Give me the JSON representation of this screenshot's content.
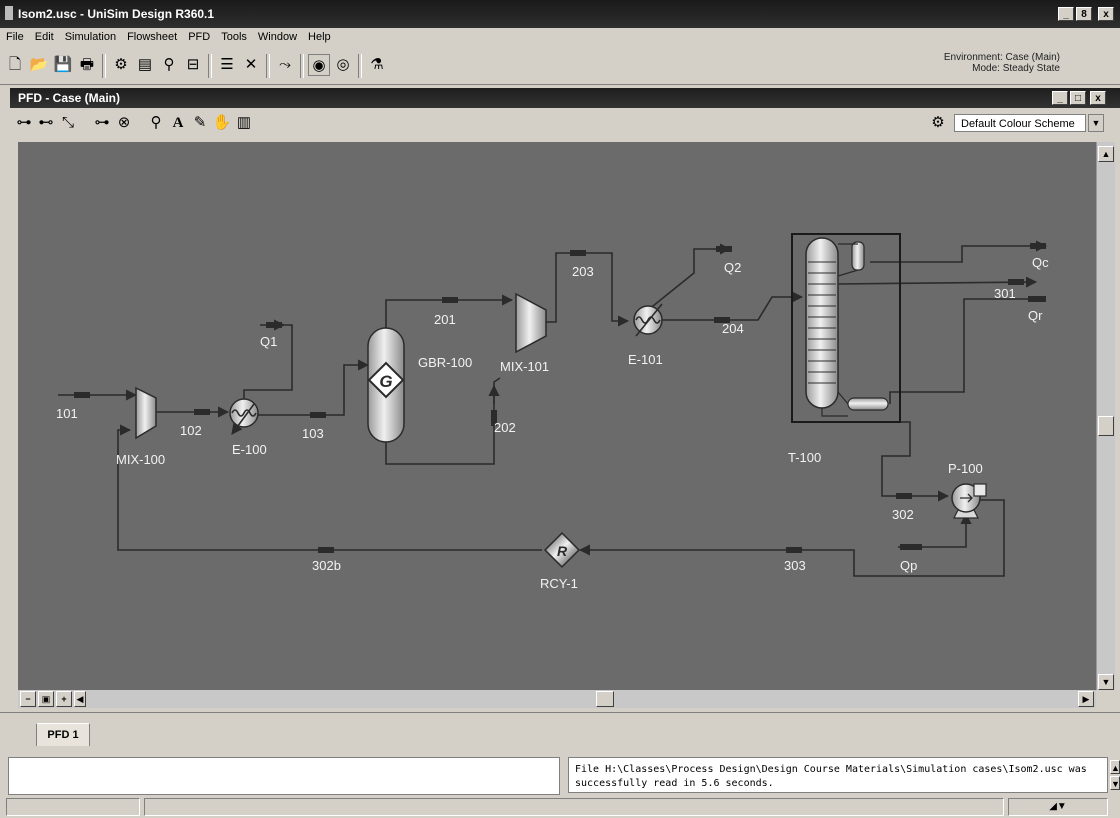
{
  "window": {
    "title": "Isom2.usc - UniSim Design R360.1",
    "min": "_",
    "max": "8",
    "close": "x"
  },
  "menu": [
    "File",
    "Edit",
    "Simulation",
    "Flowsheet",
    "PFD",
    "Tools",
    "Window",
    "Help"
  ],
  "environment": {
    "line1": "Environment: Case (Main)",
    "line2": "Mode: Steady State"
  },
  "pfd_window": {
    "title": "PFD - Case (Main)",
    "colour_scheme": "Default Colour Scheme"
  },
  "flowsheet": {
    "streams": [
      "101",
      "102",
      "103",
      "Q1",
      "201",
      "202",
      "203",
      "204",
      "Q2",
      "Qc",
      "301",
      "Qr",
      "302",
      "Qp",
      "303",
      "302b"
    ],
    "units": [
      "MIX-100",
      "E-100",
      "GBR-100",
      "MIX-101",
      "E-101",
      "T-100",
      "P-100",
      "RCY-1"
    ],
    "reactor_symbol": "G",
    "recycle_symbol": "R"
  },
  "tabs": [
    "PFD 1"
  ],
  "status": {
    "message": "File H:\\Classes\\Process Design\\Design Course Materials\\Simulation cases\\Isom2.usc was successfully read in 5.6 seconds."
  },
  "colors": {
    "canvas": "#6b6b6b",
    "line": "#2b2b2b",
    "label": "#f2f2f2",
    "titlebar": "#1e1e1e"
  }
}
